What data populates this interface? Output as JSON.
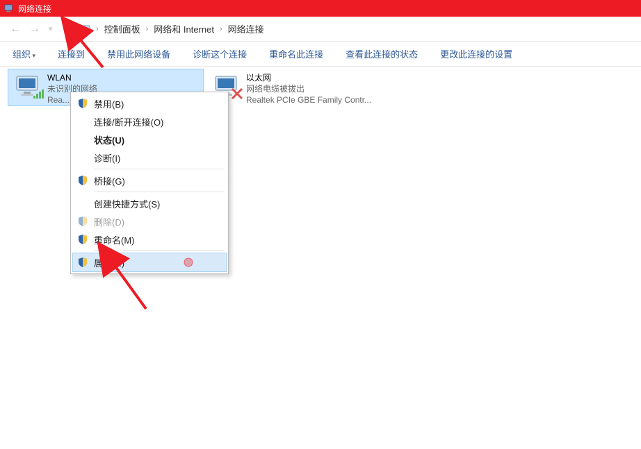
{
  "titlebar": {
    "title": "网络连接"
  },
  "breadcrumb": {
    "items": [
      "控制面板",
      "网络和 Internet",
      "网络连接"
    ]
  },
  "toolbar": {
    "organize": "组织",
    "connect": "连接到",
    "disable": "禁用此网络设备",
    "diagnose": "诊断这个连接",
    "rename": "重命名此连接",
    "status": "查看此连接的状态",
    "change": "更改此连接的设置"
  },
  "connections": {
    "wlan": {
      "name": "WLAN",
      "status": "未识别的网络",
      "adapter": "Rea..."
    },
    "ethernet": {
      "name": "以太网",
      "status": "网络电缆被拔出",
      "adapter": "Realtek PCIe GBE Family Contr..."
    }
  },
  "context_menu": {
    "disable": "禁用(B)",
    "connect": "连接/断开连接(O)",
    "status": "状态(U)",
    "diagnose": "诊断(I)",
    "bridge": "桥接(G)",
    "shortcut": "创建快捷方式(S)",
    "delete": "删除(D)",
    "rename": "重命名(M)",
    "properties": "属性(R)"
  }
}
